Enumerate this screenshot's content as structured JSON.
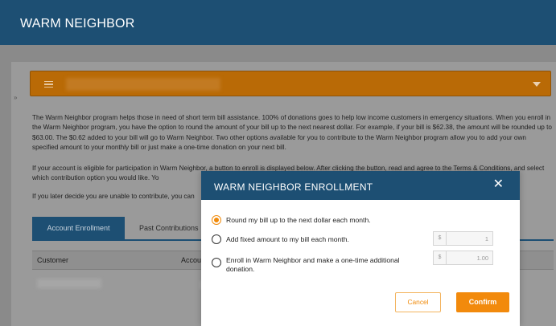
{
  "app": {
    "title": "WARM NEIGHBOR"
  },
  "page": {
    "marker": "»",
    "paragraphs": [
      "The Warm Neighbor program helps those in need of short term bill assistance. 100% of donations goes to help low income customers in emergency situations. When you enroll in the Warm Neighbor program, you have the option to round the amount of your bill up to the next nearest dollar. For example, if your bill is $62.38, the amount will be rounded up to $63.00. The $0.62 added to your bill will go to Warm Neighbor. Two other options available for you to contribute to the Warm Neighbor program allow you to add your own specified amount to your monthly bill or just make a one-time donation on your next bill.",
      "If your account is eligible for participation in Warm Neighbor, a button to enroll is displayed below. After clicking the button, read and agree to the Terms & Conditions, and select which contribution option you would like. Yo",
      "If you later decide you are unable to contribute, you can"
    ],
    "tabs": [
      "Account Enrollment",
      "Past Contributions"
    ],
    "table": {
      "columns": [
        "Customer",
        "Accou"
      ]
    }
  },
  "modal": {
    "title": "WARM NEIGHBOR ENROLLMENT",
    "close_icon": "close-icon",
    "options": [
      {
        "label": "Round my bill up to the next dollar each month.",
        "selected": true
      },
      {
        "label": "Add fixed amount to my bill each month.",
        "selected": false,
        "currency": "$",
        "amount": "1"
      },
      {
        "label": "Enroll in Warm Neighbor and make a one-time additional donation.",
        "selected": false,
        "currency": "$",
        "amount": "1.00"
      }
    ],
    "cancel_label": "Cancel",
    "confirm_label": "Confirm"
  },
  "colors": {
    "header": "#1d4f73",
    "accent": "#f28a0c",
    "dropdown": "#b96a06"
  }
}
